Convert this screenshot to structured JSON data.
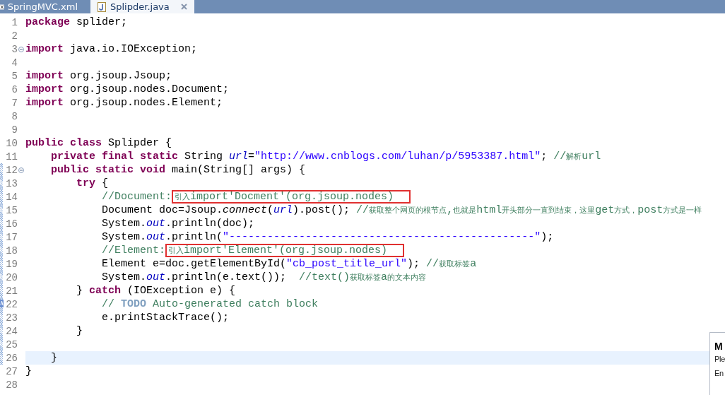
{
  "tabs": [
    {
      "label": "SpringMVC.xml",
      "kind": "xml",
      "selected": false,
      "closable": false
    },
    {
      "label": "Splipder.java",
      "kind": "java",
      "selected": true,
      "closable": true
    }
  ],
  "editor": {
    "lines": [
      {
        "number": "1",
        "changed": false,
        "foldable": false,
        "task": false,
        "current": false,
        "tokens": [
          {
            "kind": "keyword",
            "text": "package"
          },
          {
            "kind": "plain",
            "text": " splider;"
          }
        ]
      },
      {
        "number": "2",
        "changed": false,
        "foldable": false,
        "task": false,
        "current": false
      },
      {
        "number": "3",
        "changed": false,
        "foldable": true,
        "task": false,
        "current": false,
        "tokens": [
          {
            "kind": "keyword",
            "text": "import"
          },
          {
            "kind": "plain",
            "text": " java.io.IOException;"
          }
        ]
      },
      {
        "number": "4",
        "changed": false,
        "foldable": false,
        "task": false,
        "current": false
      },
      {
        "number": "5",
        "changed": false,
        "foldable": false,
        "task": false,
        "current": false,
        "tokens": [
          {
            "kind": "keyword",
            "text": "import"
          },
          {
            "kind": "plain",
            "text": " org.jsoup.Jsoup;"
          }
        ]
      },
      {
        "number": "6",
        "changed": false,
        "foldable": false,
        "task": false,
        "current": false,
        "tokens": [
          {
            "kind": "keyword",
            "text": "import"
          },
          {
            "kind": "plain",
            "text": " org.jsoup.nodes.Document;"
          }
        ]
      },
      {
        "number": "7",
        "changed": false,
        "foldable": false,
        "task": false,
        "current": false,
        "tokens": [
          {
            "kind": "keyword",
            "text": "import"
          },
          {
            "kind": "plain",
            "text": " org.jsoup.nodes.Element;"
          }
        ]
      },
      {
        "number": "8",
        "changed": false,
        "foldable": false,
        "task": false,
        "current": false
      },
      {
        "number": "9",
        "changed": false,
        "foldable": false,
        "task": false,
        "current": false
      },
      {
        "number": "10",
        "changed": false,
        "foldable": false,
        "task": false,
        "current": false,
        "tokens": [
          {
            "kind": "keyword",
            "text": "public class"
          },
          {
            "kind": "plain",
            "text": " Splipder {"
          }
        ]
      },
      {
        "number": "11",
        "changed": false,
        "foldable": false,
        "task": false,
        "current": false,
        "tokens": [
          {
            "kind": "keyword",
            "text": "    private final static"
          },
          {
            "kind": "plain",
            "text": " String "
          },
          {
            "kind": "field",
            "text": "url"
          },
          {
            "kind": "plain",
            "text": "="
          },
          {
            "kind": "string",
            "text": "\"http://www.cnblogs.com/luhan/p/5953387.html\""
          },
          {
            "kind": "plain",
            "text": "; "
          },
          {
            "kind": "comment",
            "text": "//解析url"
          }
        ]
      },
      {
        "number": "12",
        "changed": true,
        "foldable": true,
        "task": false,
        "current": false,
        "tokens": [
          {
            "kind": "keyword",
            "text": "    public static void"
          },
          {
            "kind": "plain",
            "text": " main(String[] args) {"
          }
        ]
      },
      {
        "number": "13",
        "changed": true,
        "foldable": false,
        "task": false,
        "current": false,
        "tokens": [
          {
            "kind": "keyword",
            "text": "        try"
          },
          {
            "kind": "plain",
            "text": " {"
          }
        ]
      },
      {
        "number": "14",
        "changed": true,
        "foldable": false,
        "task": false,
        "current": false,
        "tokens": [
          {
            "kind": "comment",
            "text": "            //Document:"
          },
          {
            "kind": "boxed",
            "text": "引入import'Docment'(org.jsoup.nodes)"
          }
        ]
      },
      {
        "number": "15",
        "changed": true,
        "foldable": false,
        "task": false,
        "current": false,
        "tokens": [
          {
            "kind": "plain",
            "text": "            Document doc=Jsoup."
          },
          {
            "kind": "static",
            "text": "connect"
          },
          {
            "kind": "plain",
            "text": "("
          },
          {
            "kind": "field",
            "text": "url"
          },
          {
            "kind": "plain",
            "text": ").post(); "
          },
          {
            "kind": "comment",
            "text": "//获取整个网页的根节点,也就是html开头部分一直到结束，这里get方式，post方式是一样"
          }
        ]
      },
      {
        "number": "16",
        "changed": true,
        "foldable": false,
        "task": false,
        "current": false,
        "tokens": [
          {
            "kind": "plain",
            "text": "            System."
          },
          {
            "kind": "field",
            "text": "out"
          },
          {
            "kind": "plain",
            "text": ".println(doc);"
          }
        ]
      },
      {
        "number": "17",
        "changed": true,
        "foldable": false,
        "task": false,
        "current": false,
        "tokens": [
          {
            "kind": "plain",
            "text": "            System."
          },
          {
            "kind": "field",
            "text": "out"
          },
          {
            "kind": "plain",
            "text": ".println("
          },
          {
            "kind": "string",
            "text": "\"------------------------------------------------\""
          },
          {
            "kind": "plain",
            "text": ");"
          }
        ]
      },
      {
        "number": "18",
        "changed": true,
        "foldable": false,
        "task": false,
        "current": false,
        "tokens": [
          {
            "kind": "comment",
            "text": "            //Element:"
          },
          {
            "kind": "boxed",
            "text": "引入import'Element'(org.jsoup.nodes)"
          }
        ]
      },
      {
        "number": "19",
        "changed": true,
        "foldable": false,
        "task": false,
        "current": false,
        "tokens": [
          {
            "kind": "plain",
            "text": "            Element e=doc.getElementById("
          },
          {
            "kind": "string",
            "text": "\"cb_post_title_url\""
          },
          {
            "kind": "plain",
            "text": "); "
          },
          {
            "kind": "comment",
            "text": "//获取标签a"
          }
        ]
      },
      {
        "number": "20",
        "changed": true,
        "foldable": false,
        "task": false,
        "current": false,
        "tokens": [
          {
            "kind": "plain",
            "text": "            System."
          },
          {
            "kind": "field",
            "text": "out"
          },
          {
            "kind": "plain",
            "text": ".println(e.text());  "
          },
          {
            "kind": "comment",
            "text": "//text()获取标签a的文本内容"
          }
        ]
      },
      {
        "number": "21",
        "changed": true,
        "foldable": false,
        "task": false,
        "current": false,
        "tokens": [
          {
            "kind": "plain",
            "text": "        } "
          },
          {
            "kind": "keyword",
            "text": "catch"
          },
          {
            "kind": "plain",
            "text": " (IOException e) {"
          }
        ]
      },
      {
        "number": "22",
        "changed": true,
        "foldable": false,
        "task": true,
        "current": false,
        "tokens": [
          {
            "kind": "comment",
            "text": "            // "
          },
          {
            "kind": "todo",
            "text": "TODO"
          },
          {
            "kind": "comment",
            "text": " Auto-generated catch block"
          }
        ]
      },
      {
        "number": "23",
        "changed": true,
        "foldable": false,
        "task": false,
        "current": false,
        "tokens": [
          {
            "kind": "plain",
            "text": "            e.printStackTrace();"
          }
        ]
      },
      {
        "number": "24",
        "changed": true,
        "foldable": false,
        "task": false,
        "current": false,
        "tokens": [
          {
            "kind": "plain",
            "text": "        }"
          }
        ]
      },
      {
        "number": "25",
        "changed": true,
        "foldable": false,
        "task": false,
        "current": false
      },
      {
        "number": "26",
        "changed": true,
        "foldable": false,
        "task": false,
        "current": true,
        "tokens": [
          {
            "kind": "plain",
            "text": "    }"
          }
        ]
      },
      {
        "number": "27",
        "changed": false,
        "foldable": false,
        "task": false,
        "current": false,
        "tokens": [
          {
            "kind": "plain",
            "text": "}"
          }
        ]
      },
      {
        "number": "28",
        "changed": false,
        "foldable": false,
        "task": false,
        "current": false
      }
    ]
  },
  "popup": {
    "title": "M",
    "lines": [
      "Ple",
      "En"
    ]
  }
}
